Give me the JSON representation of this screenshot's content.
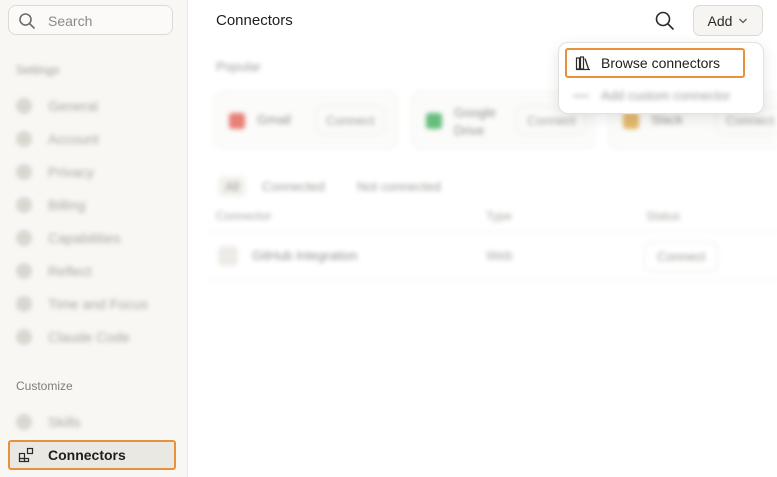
{
  "sidebar": {
    "search_placeholder": "Search",
    "settings_label": "Settings",
    "settings_items": [
      "General",
      "Account",
      "Privacy",
      "Billing",
      "Capabilities",
      "Reflect",
      "Time and Focus",
      "Claude Code"
    ],
    "customize_label": "Customize",
    "customize_items": [
      "Skills"
    ],
    "active_item": "Connectors"
  },
  "header": {
    "title": "Connectors",
    "add_label": "Add"
  },
  "dropdown": {
    "items": [
      "Browse connectors",
      "Add custom connector"
    ]
  },
  "popular": {
    "label": "Popular",
    "cards": [
      {
        "name": "Gmail",
        "button": "Connect"
      },
      {
        "name": "Google Drive",
        "button": "Connect"
      },
      {
        "name": "Slack",
        "button": "Connect"
      }
    ]
  },
  "filters": [
    "All",
    "Connected",
    "Not connected"
  ],
  "table": {
    "headers": [
      "Connector",
      "Type",
      "Status"
    ],
    "rows": [
      {
        "name": "GitHub Integration",
        "type": "Web",
        "status": "Connect"
      }
    ]
  },
  "colors": {
    "highlight": "#e8903a",
    "sidebar_bg": "#f8f7f4"
  }
}
